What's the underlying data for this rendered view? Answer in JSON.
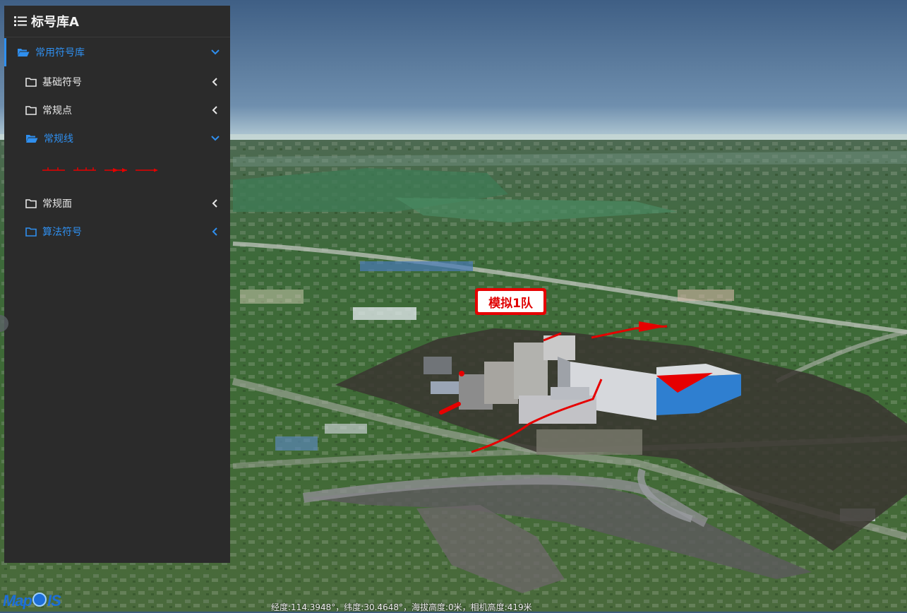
{
  "panel": {
    "title": "标号库A",
    "title_icon": "list-icon",
    "tree": [
      {
        "label": "常用符号库",
        "icon": "folder-open-icon",
        "expanded": true,
        "active": true,
        "level": 0
      },
      {
        "label": "基础符号",
        "icon": "folder-icon",
        "expanded": false,
        "active": false,
        "level": 1
      },
      {
        "label": "常规点",
        "icon": "folder-icon",
        "expanded": false,
        "active": false,
        "level": 1
      },
      {
        "label": "常规线",
        "icon": "folder-open-icon",
        "expanded": true,
        "active": true,
        "level": 1
      },
      {
        "label": "常规面",
        "icon": "folder-icon",
        "expanded": false,
        "active": false,
        "level": 1
      },
      {
        "label": "算法符号",
        "icon": "folder-icon",
        "expanded": false,
        "active": true,
        "level": 1
      }
    ],
    "line_symbols": [
      "line-symbol-1",
      "line-symbol-2",
      "line-symbol-3",
      "line-symbol-4"
    ]
  },
  "scene": {
    "callout_label": "模拟1队"
  },
  "logo": {
    "text_left": "Map",
    "text_right": "IS"
  },
  "status": "经度:114.3948°，纬度:30.4648°，海拔高度:0米，相机高度:419米",
  "colors": {
    "accent": "#2f8fef",
    "panel_bg": "#2b2b2b",
    "symbol_red": "#e60000"
  }
}
